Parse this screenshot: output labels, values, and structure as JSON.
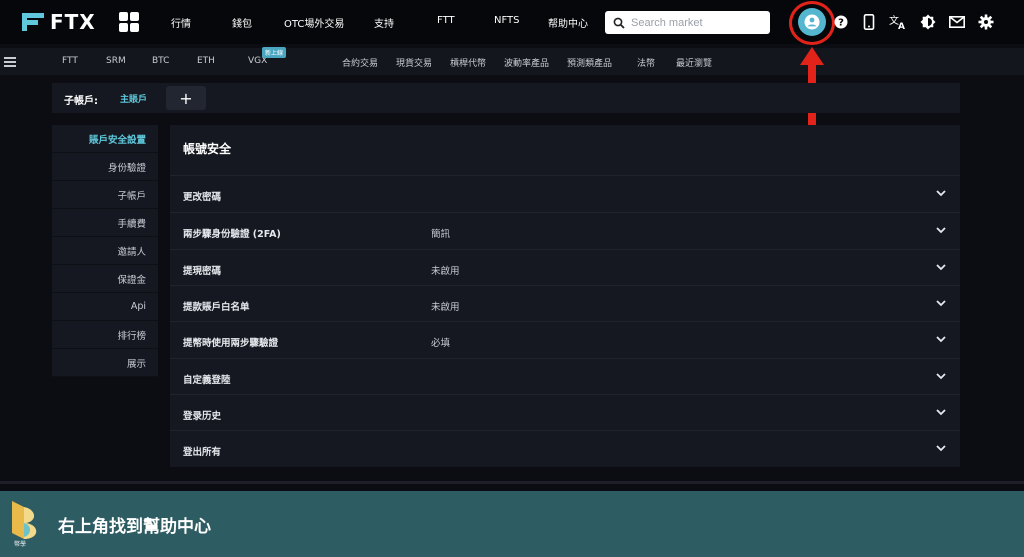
{
  "header": {
    "logo_text": "FTX",
    "nav": [
      "行情",
      "錢包",
      "OTC場外交易",
      "支持",
      "FTT",
      "NFTS",
      "帮助中心"
    ],
    "search_placeholder": "Search market",
    "icons": [
      "account-icon",
      "help-icon",
      "phone-icon",
      "translate-icon",
      "theme-toggle-icon",
      "mail-icon",
      "settings-icon"
    ]
  },
  "subnav": {
    "left_items": [
      "FTT",
      "SRM",
      "BTC",
      "ETH",
      "VGX"
    ],
    "new_badge": "新上線",
    "right_items": [
      "合約交易",
      "現貨交易",
      "槓桿代幣",
      "波動率產品",
      "預測類產品",
      "法幣",
      "最近瀏覽"
    ]
  },
  "account_bar": {
    "label": "子帳戶:",
    "main": "主賬戶",
    "add": "+"
  },
  "sidebar": {
    "items": [
      "賬戶安全設置",
      "身份驗證",
      "子帳戶",
      "手續費",
      "邀請人",
      "保證金",
      "Api",
      "排行榜",
      "展示"
    ],
    "active_index": 0
  },
  "panel": {
    "title": "帳號安全",
    "rows": [
      {
        "label": "更改密碼",
        "value": ""
      },
      {
        "label": "兩步驟身份驗證 (2FA)",
        "value": "簡訊"
      },
      {
        "label": "提現密碼",
        "value": "未啟用"
      },
      {
        "label": "提款賬戶白名单",
        "value": "未啟用"
      },
      {
        "label": "提幣時使用兩步驟驗證",
        "value": "必填"
      },
      {
        "label": "自定義登陸",
        "value": ""
      },
      {
        "label": "登录历史",
        "value": ""
      },
      {
        "label": "登出所有",
        "value": ""
      }
    ]
  },
  "footer": {
    "caption": "右上角找到幫助中心",
    "logo_text": "幣學"
  },
  "colors": {
    "accent": "#5fc8dc",
    "highlight_red": "#e2231a",
    "footer_bg": "#2d5c63"
  }
}
